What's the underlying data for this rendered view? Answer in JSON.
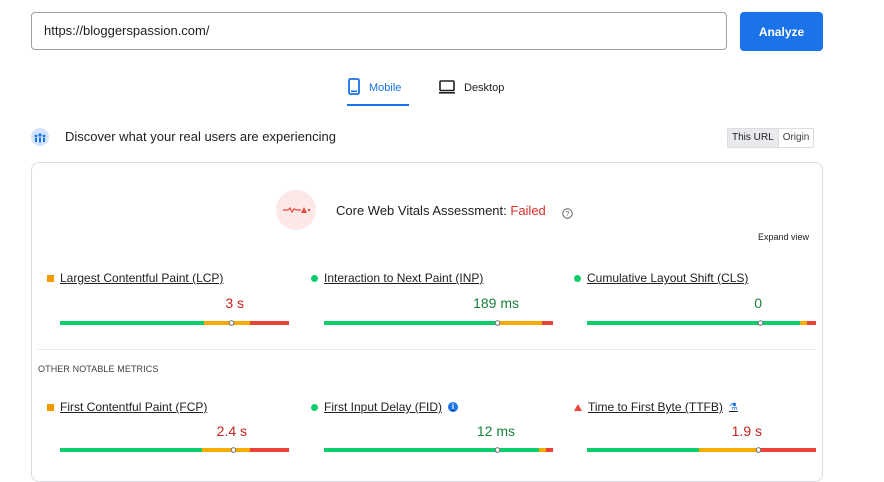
{
  "search": {
    "url_value": "https://bloggerspassion.com/"
  },
  "analyze_label": "Analyze",
  "tabs": [
    {
      "label": "Mobile"
    },
    {
      "label": "Desktop"
    }
  ],
  "users": {
    "heading": "Discover what your real users are experiencing",
    "toggle": {
      "this_url": "This URL",
      "origin": "Origin"
    }
  },
  "assessment": {
    "prefix": "Core Web Vitals Assessment: ",
    "status": "Failed",
    "expand": "Expand view"
  },
  "other_heading": "OTHER NOTABLE METRICS",
  "metrics": [
    {
      "title": "Largest Contentful Paint (LCP)",
      "value": "3 s",
      "status": "needs-improvement",
      "distribution": [
        0.63,
        0.2,
        0.17
      ],
      "marker_pos": 0.75
    },
    {
      "title": "Interaction to Next Paint (INP)",
      "value": "189 ms",
      "status": "good",
      "distribution": [
        0.77,
        0.18,
        0.05
      ],
      "marker_pos": 0.76
    },
    {
      "title": "Cumulative Layout Shift (CLS)",
      "value": "0",
      "status": "good",
      "distribution": [
        0.93,
        0.03,
        0.04
      ],
      "marker_pos": 0.76
    },
    {
      "title": "First Contentful Paint (FCP)",
      "value": "2.4 s",
      "status": "needs-improvement",
      "distribution": [
        0.62,
        0.21,
        0.17
      ],
      "marker_pos": 0.76
    },
    {
      "title": "First Input Delay (FID)",
      "value": "12 ms",
      "status": "good",
      "distribution": [
        0.94,
        0.03,
        0.03
      ],
      "marker_pos": 0.76
    },
    {
      "title": "Time to First Byte (TTFB)",
      "value": "1.9 s",
      "status": "poor",
      "distribution": [
        0.49,
        0.26,
        0.25
      ],
      "marker_pos": 0.75
    }
  ],
  "colors": {
    "good": "#0cce6b",
    "needs_improvement": "#f9ab00",
    "poor": "#ea4335",
    "accent": "#1a73e8",
    "fail_text": "#d93025"
  }
}
